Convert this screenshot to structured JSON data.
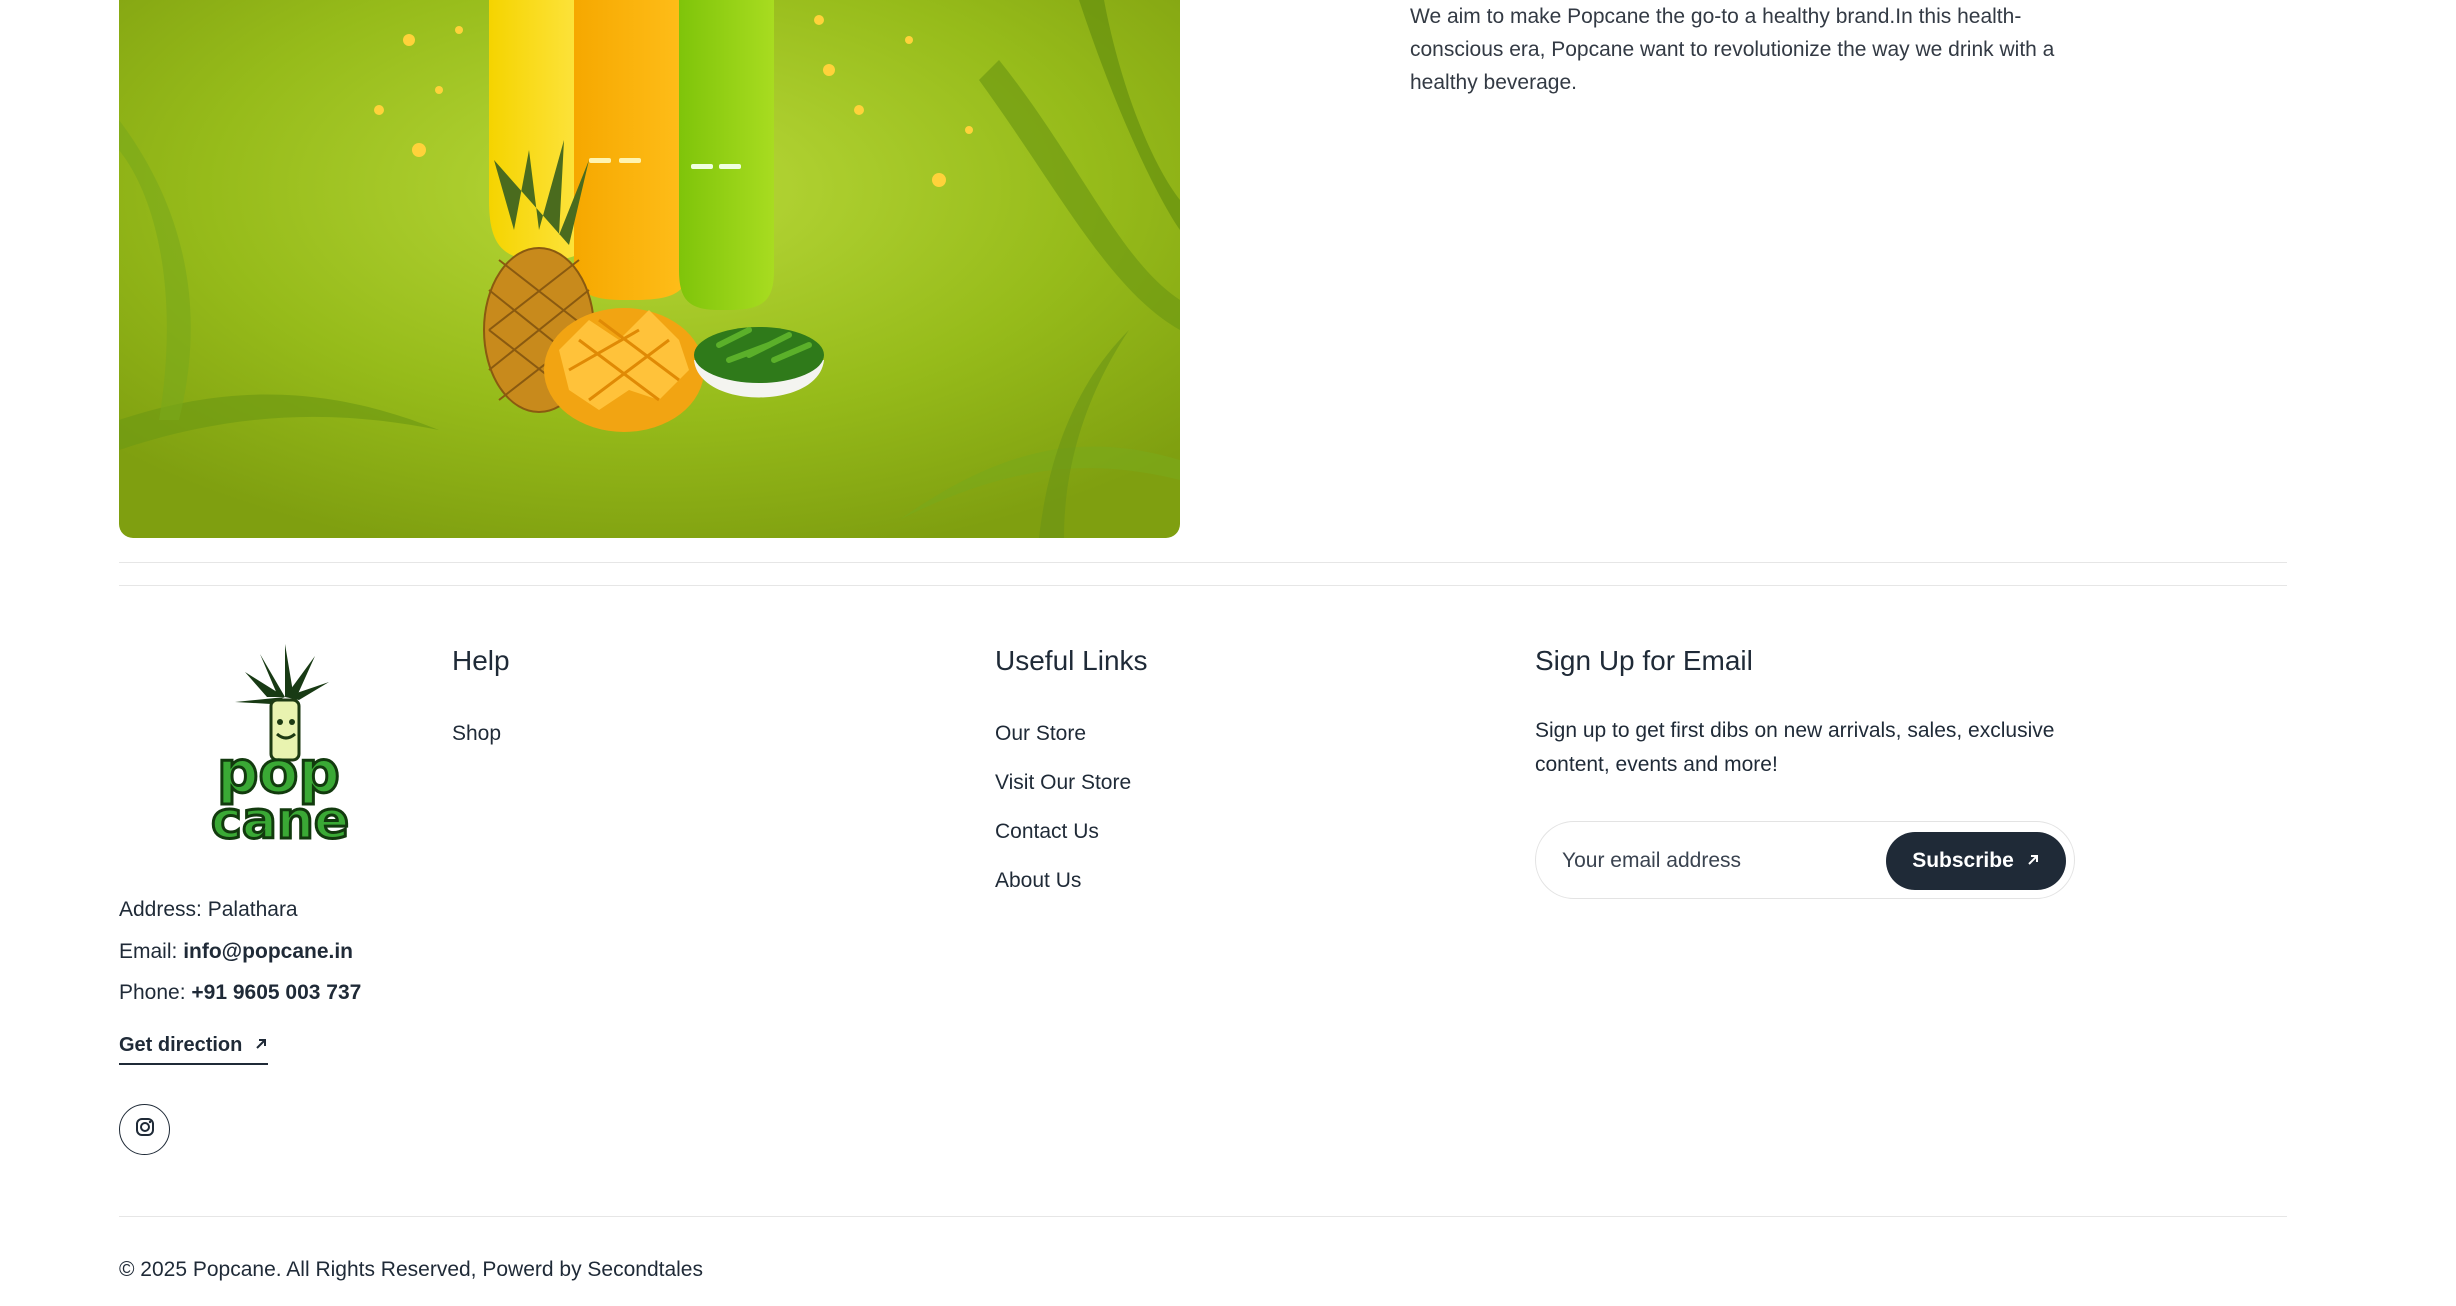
{
  "about": {
    "text": "We aim to make Popcane the go-to a healthy brand.In this health-conscious era, Popcane want to revolutionize the way we drink with a healthy beverage."
  },
  "footer": {
    "logo_text": "Popcane",
    "contact": {
      "address_label": "Address:",
      "address_value": "Palathara",
      "email_label": "Email:",
      "email_value": "info@popcane.in",
      "phone_label": "Phone:",
      "phone_value": "+91 9605 003 737"
    },
    "get_direction": "Get direction",
    "help": {
      "title": "Help",
      "links": [
        "Shop"
      ]
    },
    "useful_links": {
      "title": "Useful Links",
      "links": [
        "Our Store",
        "Visit Our Store",
        "Contact Us",
        "About Us"
      ]
    },
    "signup": {
      "title": "Sign Up for Email",
      "text": "Sign up to get first dibs on new arrivals, sales, exclusive content, events and more!",
      "placeholder": "Your email address",
      "button": "Subscribe"
    },
    "copyright": "© 2025 Popcane. All Rights Reserved, Powerd by Secondtales"
  },
  "colors": {
    "text": "#1f2a37",
    "button_bg": "#1f2a37",
    "brand_green": "#3aa935",
    "hero_green": "#9cc21e"
  },
  "icons": [
    "arrow-up-right-icon",
    "instagram-icon"
  ]
}
